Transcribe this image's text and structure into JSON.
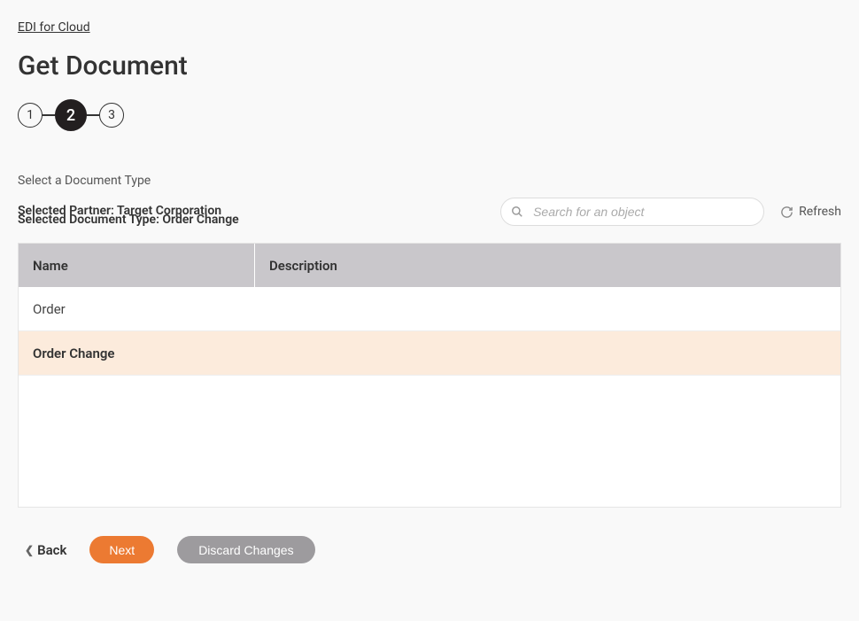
{
  "breadcrumb": {
    "label": "EDI for Cloud"
  },
  "page": {
    "title": "Get Document"
  },
  "stepper": {
    "steps": [
      "1",
      "2",
      "3"
    ],
    "active_index": 1
  },
  "section": {
    "label": "Select a Document Type"
  },
  "selected": {
    "partner_label": "Selected Partner: Target Corporation",
    "doctype_label": "Selected Document Type: Order Change"
  },
  "search": {
    "placeholder": "Search for an object"
  },
  "refresh": {
    "label": "Refresh"
  },
  "table": {
    "headers": {
      "name": "Name",
      "description": "Description"
    },
    "rows": [
      {
        "name": "Order",
        "description": "",
        "selected": false
      },
      {
        "name": "Order Change",
        "description": "",
        "selected": true
      }
    ]
  },
  "footer": {
    "back": "Back",
    "next": "Next",
    "discard": "Discard Changes"
  }
}
